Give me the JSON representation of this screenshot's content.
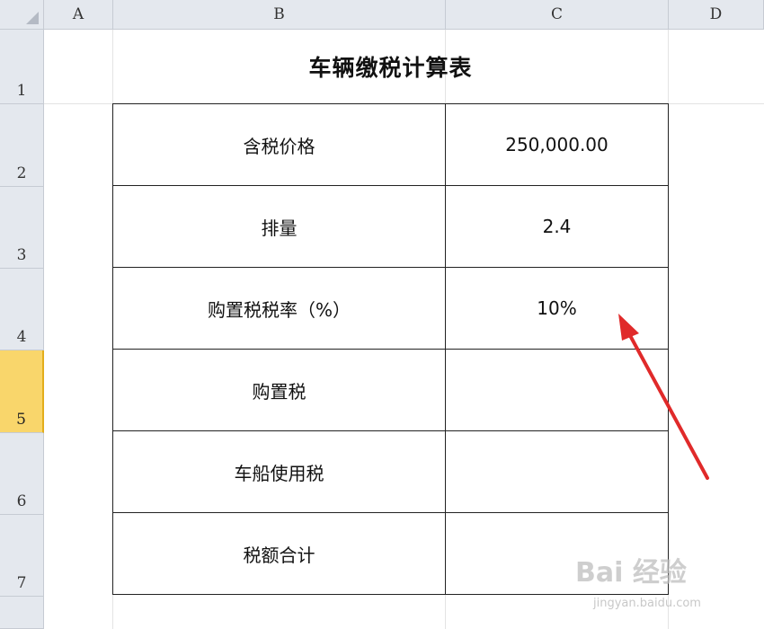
{
  "sheet": {
    "columns": [
      "A",
      "B",
      "C",
      "D"
    ],
    "rows": [
      "1",
      "2",
      "3",
      "4",
      "5",
      "6",
      "7"
    ],
    "active_row": "5"
  },
  "table": {
    "title": "车辆缴税计算表",
    "rows": [
      {
        "label": "含税价格",
        "value": "250,000.00"
      },
      {
        "label": "排量",
        "value": "2.4"
      },
      {
        "label": "购置税税率（%）",
        "value": "10%"
      },
      {
        "label": "购置税",
        "value": ""
      },
      {
        "label": "车船使用税",
        "value": ""
      },
      {
        "label": "税额合计",
        "value": ""
      }
    ]
  },
  "annotation": {
    "color": "#e02a2a"
  },
  "watermark": {
    "brand": "Bai 经验",
    "url": "jingyan.baidu.com"
  }
}
